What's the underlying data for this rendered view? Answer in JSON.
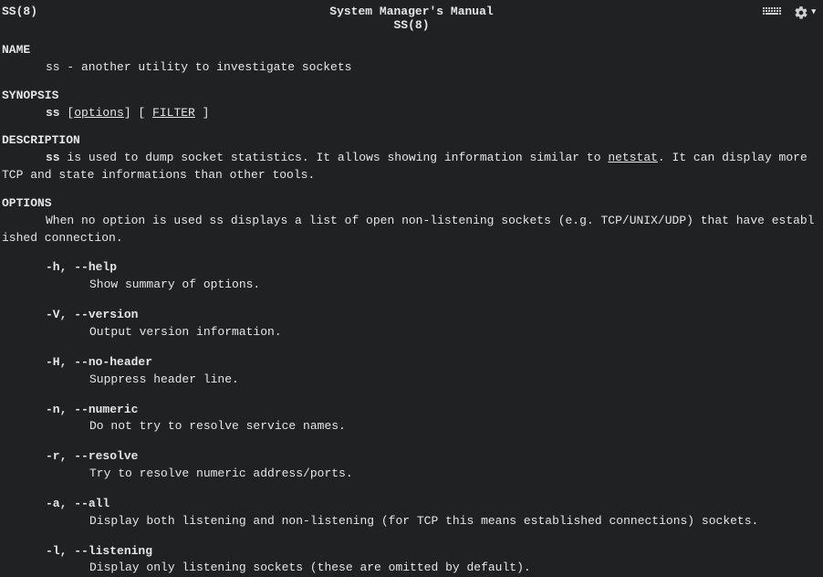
{
  "header": {
    "left": "SS(8)",
    "center_top": "System Manager's Manual",
    "center_bot": "SS(8)"
  },
  "name": {
    "title": "NAME",
    "text": "ss - another utility to investigate sockets"
  },
  "synopsis": {
    "title": "SYNOPSIS",
    "cmd": "ss ",
    "lb1": "[",
    "opt": "options",
    "rb1": "] [ ",
    "filt": "FILTER",
    "rb2": " ]"
  },
  "description": {
    "title": "DESCRIPTION",
    "lead_cmd": "ss",
    "lead_rest": " is used to dump socket statistics. It allows showing information similar to ",
    "link": "netstat",
    "after_link": ".  It can display more",
    "line2": " TCP and state informations than other tools."
  },
  "options": {
    "title": "OPTIONS",
    "intro1": "When no option is used ss displays a list of open non-listening sockets (e.g. TCP/UNIX/UDP) that have establ",
    "intro2": "ished connection.",
    "items": [
      {
        "flag_short": "-h, ",
        "flag_long": "--help",
        "desc": "Show summary of options."
      },
      {
        "flag_short": "-V, ",
        "flag_long": "--version",
        "desc": "Output version information."
      },
      {
        "flag_short": "-H, ",
        "flag_long": "--no-header",
        "desc": "Suppress header line."
      },
      {
        "flag_short": "-n, ",
        "flag_long": "--numeric",
        "desc": "Do not try to resolve service names."
      },
      {
        "flag_short": "-r, ",
        "flag_long": "--resolve",
        "desc": "Try to resolve numeric address/ports."
      },
      {
        "flag_short": "-a, ",
        "flag_long": "--all",
        "desc": "Display both listening and non-listening (for TCP this means established connections) sockets."
      },
      {
        "flag_short": "-l, ",
        "flag_long": "--listening",
        "desc": "Display only listening sockets (these are omitted by default)."
      }
    ]
  }
}
